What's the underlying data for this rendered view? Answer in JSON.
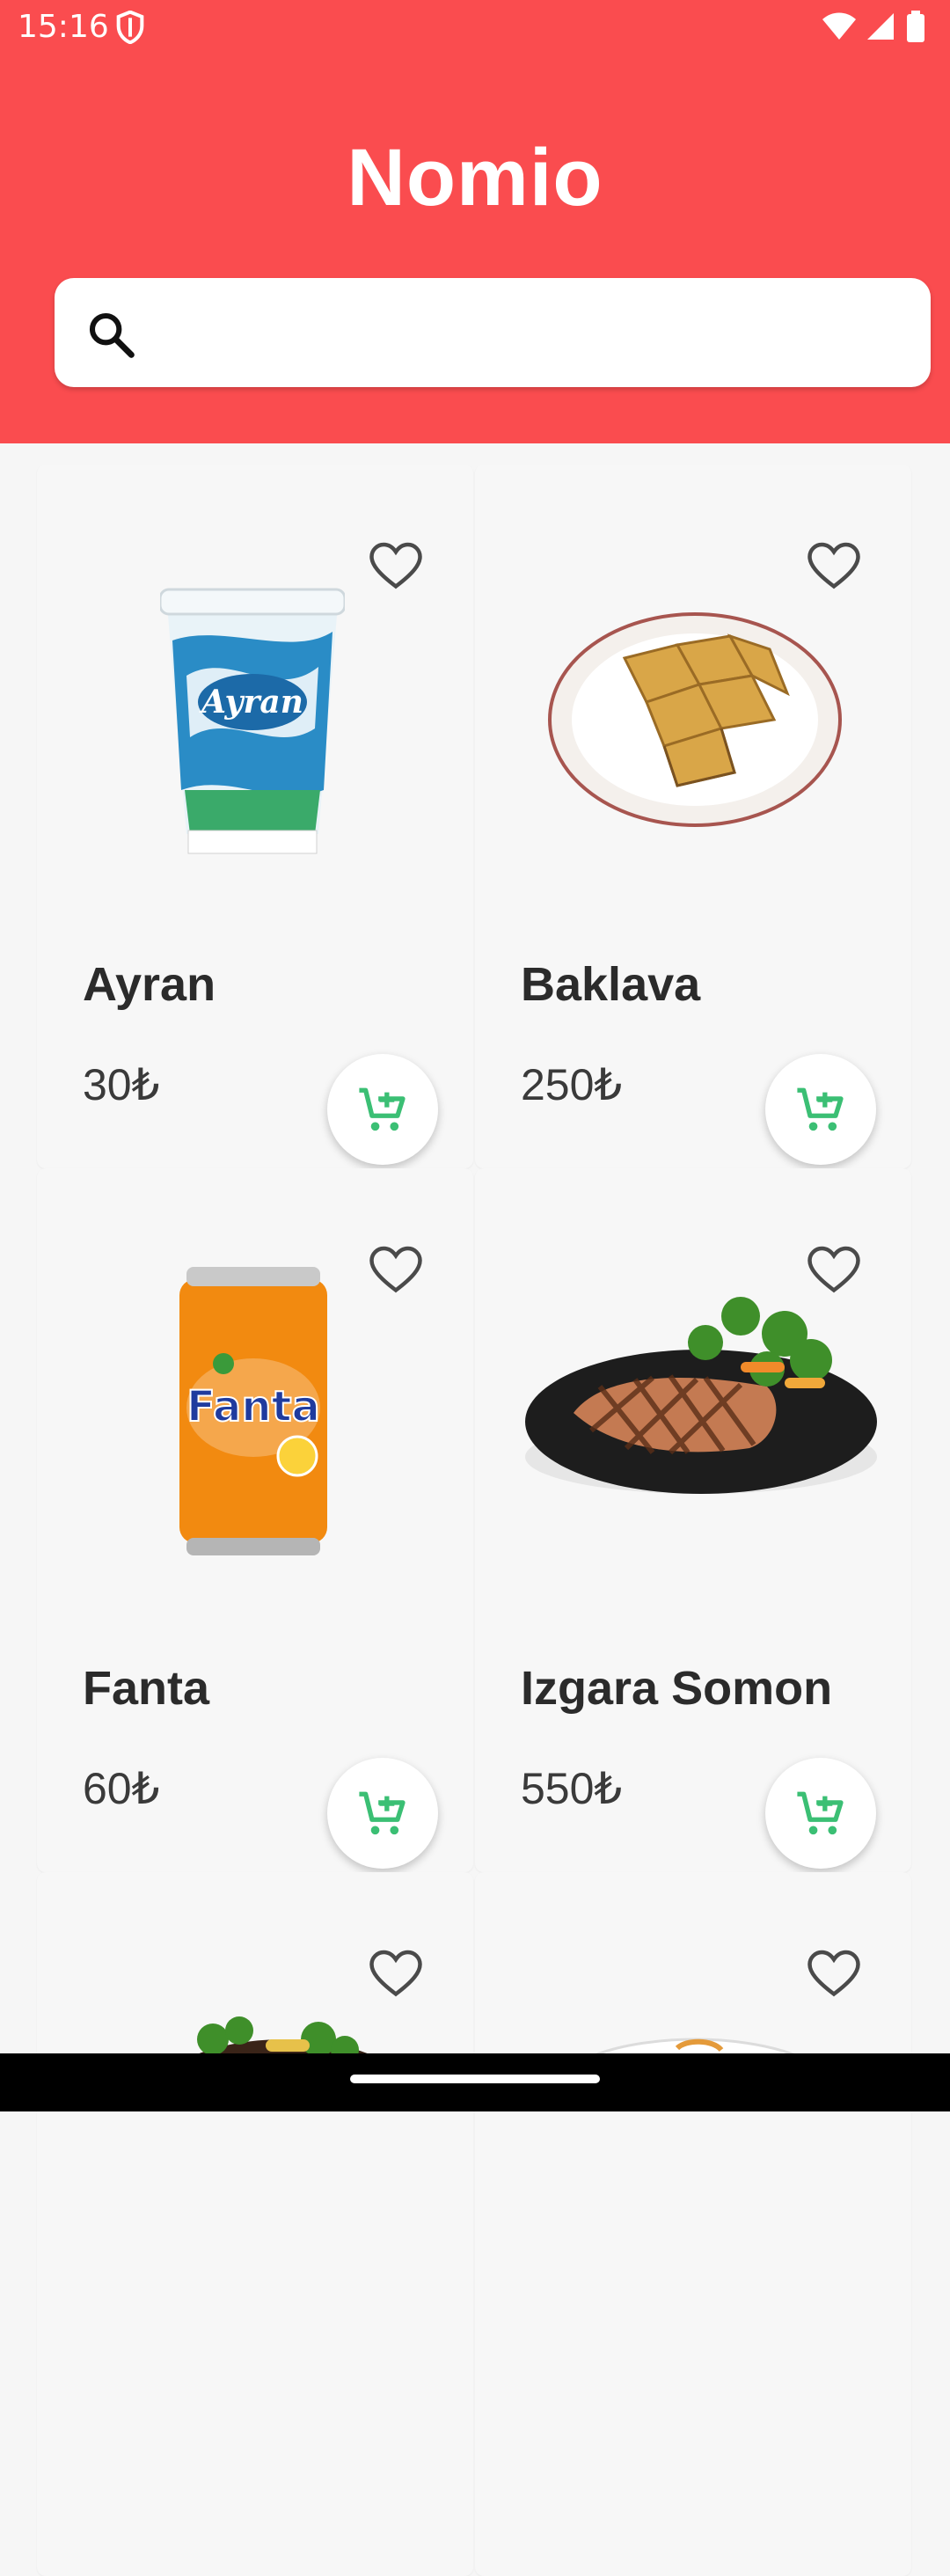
{
  "status_bar": {
    "time": "15:16"
  },
  "app": {
    "title": "Nomio"
  },
  "search": {
    "value": "",
    "placeholder": ""
  },
  "products": [
    {
      "name": "Ayran",
      "price": "30₺"
    },
    {
      "name": "Baklava",
      "price": "250₺"
    },
    {
      "name": "Fanta",
      "price": "60₺"
    },
    {
      "name": "Izgara Somon",
      "price": "550₺"
    }
  ],
  "colors": {
    "brand": "#fa4c4f",
    "cart_icon": "#3bbf74",
    "background": "#f6f6f6"
  }
}
